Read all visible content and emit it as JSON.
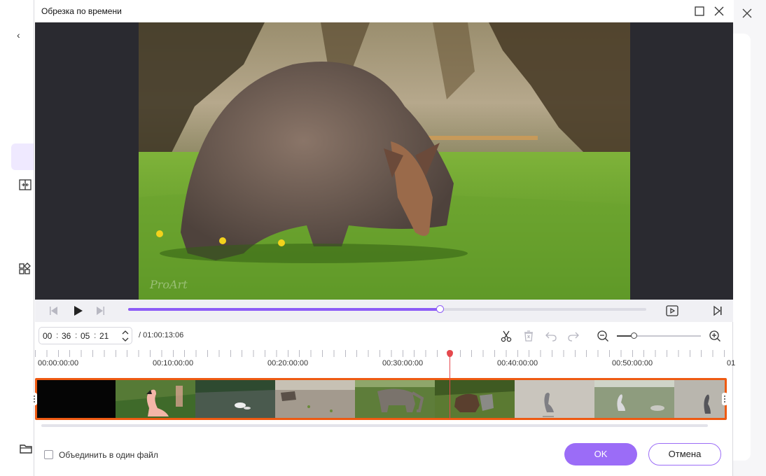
{
  "dialog": {
    "title": "Обрезка по времени",
    "maximize_icon": "maximize-icon",
    "close_icon": "close-icon"
  },
  "background_app": {
    "back_icon": "chevron-left-icon",
    "sidebar_icons": [
      "split-icon",
      "grid-icon",
      "folder-icon"
    ],
    "close_icon": "close-icon"
  },
  "player": {
    "watermark": "ProArt",
    "progress_fraction": 0.601,
    "icons": [
      "prev-frame-icon",
      "play-icon",
      "next-frame-icon",
      "preview-icon",
      "skip-end-icon"
    ]
  },
  "time": {
    "hh": "00",
    "mm": "36",
    "ss": "05",
    "ff": "21",
    "duration": "/ 01:00:13:06"
  },
  "tools": {
    "icons": [
      "scissors-icon",
      "trash-icon",
      "undo-icon",
      "redo-icon",
      "zoom-out-icon",
      "zoom-in-icon"
    ],
    "zoom_fraction": 0.2
  },
  "timeline": {
    "ticks": [
      "00:00:00:00",
      "00:10:00:00",
      "00:20:00:00",
      "00:30:00:00",
      "00:40:00:00",
      "00:50:00:00",
      "01"
    ],
    "playhead_fraction": 0.601
  },
  "footer": {
    "merge_label": "Объединить в один файл",
    "merge_checked": false,
    "ok_label": "OK",
    "cancel_label": "Отмена"
  },
  "colors": {
    "accent": "#9b6cf7",
    "selection_border": "#ee5a12",
    "playhead": "#e5484d"
  }
}
